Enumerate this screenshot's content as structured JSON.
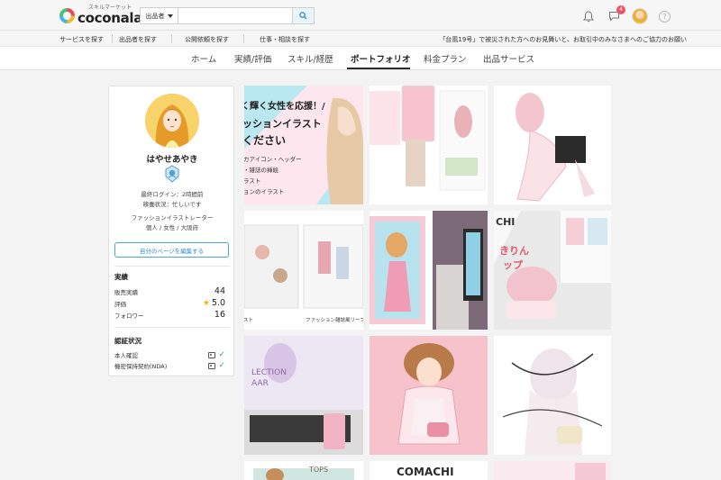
{
  "header": {
    "logo_sub": "スキルマーケット",
    "logo_main": "coconala",
    "search_category": "出品者",
    "search_placeholder": "",
    "notification_count": "4"
  },
  "subnav": {
    "items": [
      "サービスを探す",
      "出品者を探す",
      "公開依頼を探す",
      "仕事・相談を探す"
    ],
    "notice": "「台風19号」で被災された方へのお見舞いと、お取引中のみなさまへのご協力のお願い"
  },
  "tabs": [
    "ホーム",
    "実績/評価",
    "スキル/経歴",
    "ポートフォリオ",
    "料金プラン",
    "出品サービス"
  ],
  "active_tab": "ポートフォリオ",
  "profile": {
    "name": "はやせあやき",
    "last_login": "最終ログイン：2時間前",
    "status": "稼働状況：忙しいです",
    "occupation": "ファッションイラストレーター",
    "attributes": "個人 / 女性 / 大阪府",
    "edit_button": "自分のページを編集する",
    "achievements_title": "実績",
    "stats": [
      {
        "label": "販売実績",
        "value": "44"
      },
      {
        "label": "評価",
        "value": "5.0"
      },
      {
        "label": "フォロワー",
        "value": "16"
      }
    ],
    "verification_title": "認証状況",
    "verifications": [
      "本人確認",
      "機密保持契約(NDA)"
    ]
  },
  "gallery": {
    "tile1_lines": [
      "く輝く女性を応援！/",
      "ッションイラスト",
      "ください"
    ],
    "tile1_sub": [
      "カアイコン・ヘッダー",
      "・雑誌の挿絵",
      "ラスト",
      "ョンのイラスト"
    ],
    "tile5_caption_a": "スト",
    "tile5_caption_b": "ファッション雑誌風リーフレット",
    "tile8_lines": [
      "CHI",
      "きりん",
      "ップ"
    ],
    "tile9_text": "LECTION",
    "tile9_text_b": "AAR",
    "tile12_text_a": "TOPS",
    "tile12_text_b": "COMACHI"
  },
  "colors": {
    "accent_blue": "#2c8fc9",
    "badge_red": "#e9546b",
    "star_yellow": "#f5b800",
    "check_green": "#3aa86a"
  }
}
